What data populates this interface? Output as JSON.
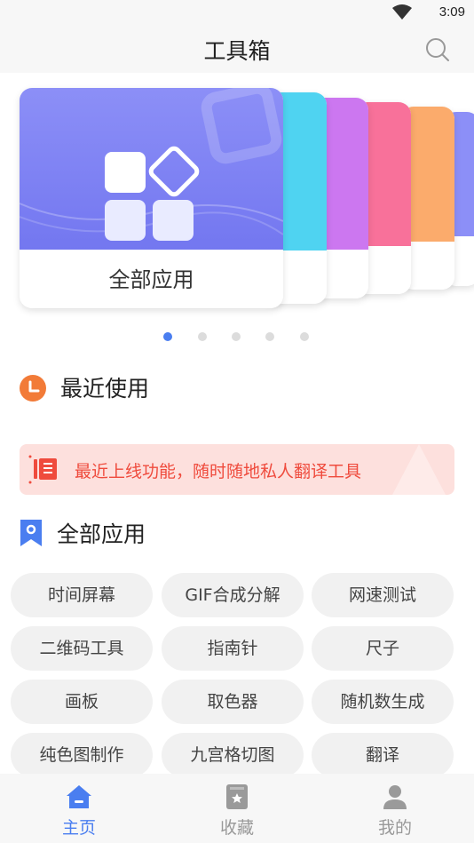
{
  "status_bar": {
    "time": "3:09"
  },
  "header": {
    "title": "工具箱"
  },
  "carousel": {
    "main_card_label": "全部应用",
    "dots_total": 5,
    "active_index": 0,
    "card_colors": [
      "#7377f0",
      "#4fd3f1",
      "#cc77f0",
      "#f8719a",
      "#fbab6c",
      "#8c8ff7"
    ]
  },
  "recent": {
    "title": "最近使用",
    "banner_text": "最近上线功能，随时随地私人翻译工具"
  },
  "apps": {
    "title": "全部应用",
    "items": [
      "时间屏幕",
      "GIF合成分解",
      "网速测试",
      "二维码工具",
      "指南针",
      "尺子",
      "画板",
      "取色器",
      "随机数生成",
      "纯色图制作",
      "九宫格切图",
      "翻译"
    ]
  },
  "nav": {
    "items": [
      {
        "label": "主页",
        "icon": "home-icon",
        "active": true
      },
      {
        "label": "收藏",
        "icon": "bookmark-box-icon",
        "active": false
      },
      {
        "label": "我的",
        "icon": "user-icon",
        "active": false
      }
    ]
  },
  "colors": {
    "accent": "#4a7ef0",
    "recent_icon": "#f27b38",
    "banner_bg": "#fde0dd",
    "banner_text": "#ef4b3d"
  }
}
